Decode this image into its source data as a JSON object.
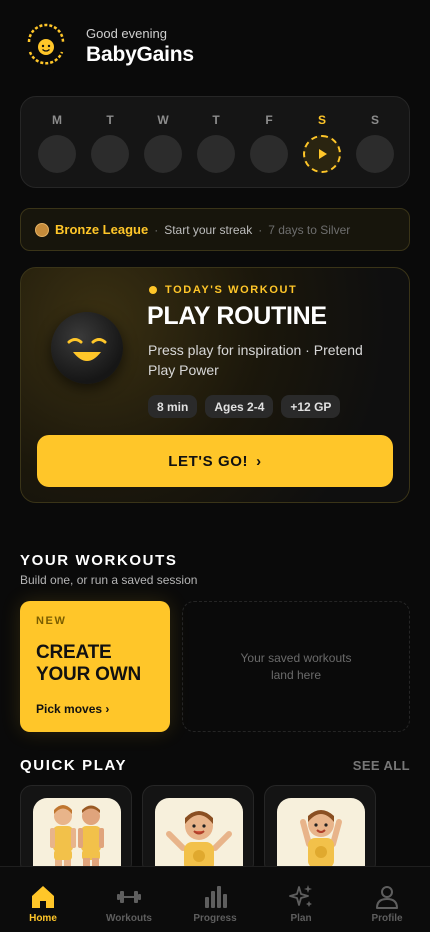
{
  "header": {
    "greeting": "Good evening",
    "app_name": "BabyGains",
    "logo_text": "BABY GAINS"
  },
  "week": {
    "days": [
      {
        "label": "M",
        "active": false
      },
      {
        "label": "T",
        "active": false
      },
      {
        "label": "W",
        "active": false
      },
      {
        "label": "T",
        "active": false
      },
      {
        "label": "F",
        "active": false
      },
      {
        "label": "S",
        "active": true
      },
      {
        "label": "S",
        "active": false
      }
    ]
  },
  "league": {
    "name": "Bronze League",
    "separator": "·",
    "status": "Start your streak",
    "detail": "7 days to Silver"
  },
  "today": {
    "tag": "TODAY'S WORKOUT",
    "title": "PLAY ROUTINE",
    "description": "Press play for inspiration · Pretend Play Power",
    "chips": [
      "8 min",
      "Ages 2-4",
      "+12 GP"
    ],
    "button": "LET'S GO!",
    "button_chevron": "›"
  },
  "your_workouts": {
    "title": "YOUR WORKOUTS",
    "subtitle": "Build one, or run a saved session",
    "create": {
      "badge": "NEW",
      "title_line1": "CREATE",
      "title_line2": "YOUR OWN",
      "link": "Pick moves ›"
    },
    "saved_placeholder_line1": "Your saved workouts",
    "saved_placeholder_line2": "land here"
  },
  "quick_play": {
    "title": "QUICK PLAY",
    "see_all": "SEE ALL"
  },
  "tabs": [
    {
      "label": "Home",
      "icon": "home-icon",
      "active": true
    },
    {
      "label": "Workouts",
      "icon": "dumbbell-icon",
      "active": false
    },
    {
      "label": "Progress",
      "icon": "bar-chart-icon",
      "active": false
    },
    {
      "label": "Plan",
      "icon": "sparkles-icon",
      "active": false
    },
    {
      "label": "Profile",
      "icon": "user-icon",
      "active": false
    }
  ],
  "colors": {
    "accent": "#ffc629",
    "background": "#0a0a0a",
    "card": "#151515",
    "bronze": "#c58b3b"
  }
}
